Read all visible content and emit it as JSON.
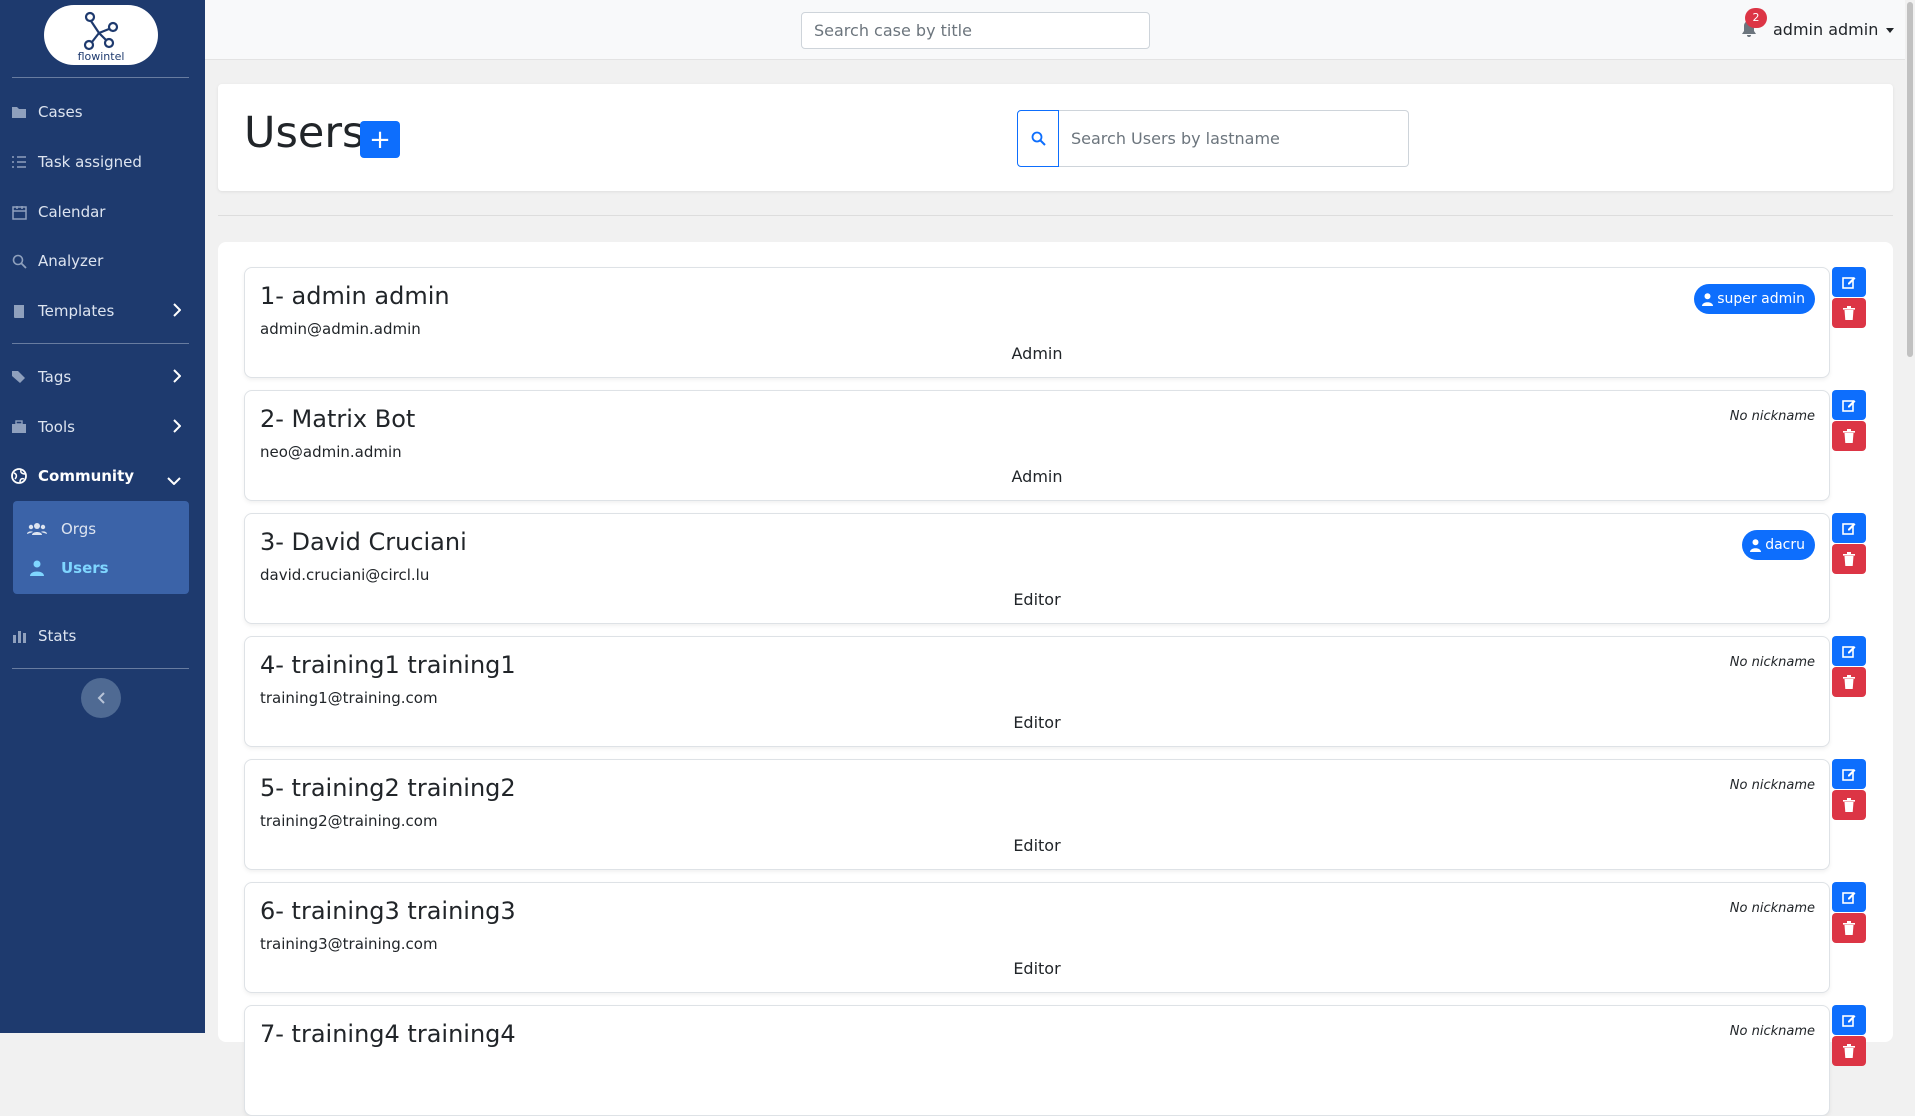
{
  "brand": {
    "name": "flowintel"
  },
  "sidebar": {
    "items": [
      {
        "label": "Cases",
        "icon": "folder-icon"
      },
      {
        "label": "Task assigned",
        "icon": "list-check-icon"
      },
      {
        "label": "Calendar",
        "icon": "calendar-icon"
      },
      {
        "label": "Analyzer",
        "icon": "search-icon"
      },
      {
        "label": "Templates",
        "icon": "book-icon"
      },
      {
        "label": "Tags",
        "icon": "tags-icon"
      },
      {
        "label": "Tools",
        "icon": "toolbox-icon"
      },
      {
        "label": "Community",
        "icon": "globe-icon"
      },
      {
        "label": "Stats",
        "icon": "bar-chart-icon"
      }
    ],
    "community_sub": [
      {
        "label": "Orgs",
        "icon": "users-icon"
      },
      {
        "label": "Users",
        "icon": "user-icon"
      }
    ]
  },
  "topbar": {
    "search_placeholder": "Search case by title",
    "notification_count": "2",
    "user_label": "admin admin"
  },
  "page": {
    "title": "Users",
    "add_label": "+",
    "search_placeholder": "Search Users by lastname"
  },
  "users": [
    {
      "name": "1- admin admin",
      "email": "admin@admin.admin",
      "role": "Admin",
      "nickname": "super admin"
    },
    {
      "name": "2- Matrix Bot",
      "email": "neo@admin.admin",
      "role": "Admin",
      "nickname": "No nickname"
    },
    {
      "name": "3- David Cruciani",
      "email": "david.cruciani@circl.lu",
      "role": "Editor",
      "nickname": "dacru"
    },
    {
      "name": "4- training1 training1",
      "email": "training1@training.com",
      "role": "Editor",
      "nickname": "No nickname"
    },
    {
      "name": "5- training2 training2",
      "email": "training2@training.com",
      "role": "Editor",
      "nickname": "No nickname"
    },
    {
      "name": "6- training3 training3",
      "email": "training3@training.com",
      "role": "Editor",
      "nickname": "No nickname"
    },
    {
      "name": "7- training4 training4",
      "email": "",
      "role": "",
      "nickname": "No nickname"
    }
  ],
  "colors": {
    "sidebar": "#1e3a6e",
    "primary": "#0d6efd",
    "danger": "#dc3545",
    "active_sub": "#7fd6ff"
  }
}
